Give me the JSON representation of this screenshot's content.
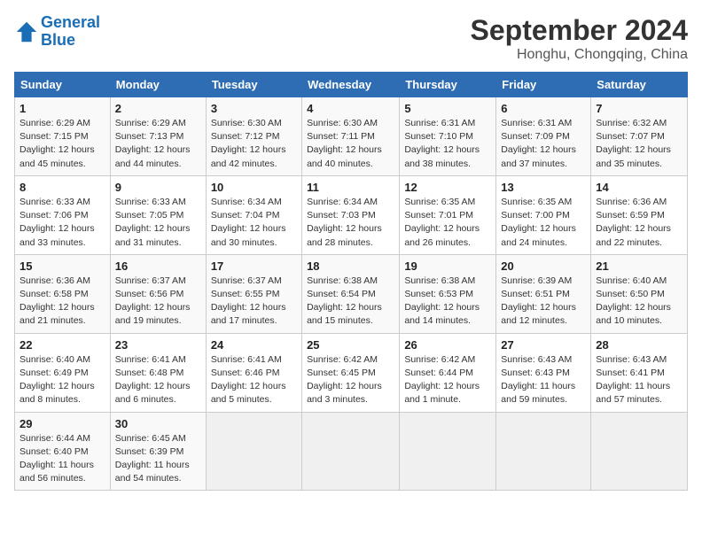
{
  "header": {
    "logo_line1": "General",
    "logo_line2": "Blue",
    "month": "September 2024",
    "location": "Honghu, Chongqing, China"
  },
  "days_of_week": [
    "Sunday",
    "Monday",
    "Tuesday",
    "Wednesday",
    "Thursday",
    "Friday",
    "Saturday"
  ],
  "weeks": [
    [
      {
        "num": "1",
        "sunrise": "6:29 AM",
        "sunset": "7:15 PM",
        "daylight": "12 hours and 45 minutes."
      },
      {
        "num": "2",
        "sunrise": "6:29 AM",
        "sunset": "7:13 PM",
        "daylight": "12 hours and 44 minutes."
      },
      {
        "num": "3",
        "sunrise": "6:30 AM",
        "sunset": "7:12 PM",
        "daylight": "12 hours and 42 minutes."
      },
      {
        "num": "4",
        "sunrise": "6:30 AM",
        "sunset": "7:11 PM",
        "daylight": "12 hours and 40 minutes."
      },
      {
        "num": "5",
        "sunrise": "6:31 AM",
        "sunset": "7:10 PM",
        "daylight": "12 hours and 38 minutes."
      },
      {
        "num": "6",
        "sunrise": "6:31 AM",
        "sunset": "7:09 PM",
        "daylight": "12 hours and 37 minutes."
      },
      {
        "num": "7",
        "sunrise": "6:32 AM",
        "sunset": "7:07 PM",
        "daylight": "12 hours and 35 minutes."
      }
    ],
    [
      {
        "num": "8",
        "sunrise": "6:33 AM",
        "sunset": "7:06 PM",
        "daylight": "12 hours and 33 minutes."
      },
      {
        "num": "9",
        "sunrise": "6:33 AM",
        "sunset": "7:05 PM",
        "daylight": "12 hours and 31 minutes."
      },
      {
        "num": "10",
        "sunrise": "6:34 AM",
        "sunset": "7:04 PM",
        "daylight": "12 hours and 30 minutes."
      },
      {
        "num": "11",
        "sunrise": "6:34 AM",
        "sunset": "7:03 PM",
        "daylight": "12 hours and 28 minutes."
      },
      {
        "num": "12",
        "sunrise": "6:35 AM",
        "sunset": "7:01 PM",
        "daylight": "12 hours and 26 minutes."
      },
      {
        "num": "13",
        "sunrise": "6:35 AM",
        "sunset": "7:00 PM",
        "daylight": "12 hours and 24 minutes."
      },
      {
        "num": "14",
        "sunrise": "6:36 AM",
        "sunset": "6:59 PM",
        "daylight": "12 hours and 22 minutes."
      }
    ],
    [
      {
        "num": "15",
        "sunrise": "6:36 AM",
        "sunset": "6:58 PM",
        "daylight": "12 hours and 21 minutes."
      },
      {
        "num": "16",
        "sunrise": "6:37 AM",
        "sunset": "6:56 PM",
        "daylight": "12 hours and 19 minutes."
      },
      {
        "num": "17",
        "sunrise": "6:37 AM",
        "sunset": "6:55 PM",
        "daylight": "12 hours and 17 minutes."
      },
      {
        "num": "18",
        "sunrise": "6:38 AM",
        "sunset": "6:54 PM",
        "daylight": "12 hours and 15 minutes."
      },
      {
        "num": "19",
        "sunrise": "6:38 AM",
        "sunset": "6:53 PM",
        "daylight": "12 hours and 14 minutes."
      },
      {
        "num": "20",
        "sunrise": "6:39 AM",
        "sunset": "6:51 PM",
        "daylight": "12 hours and 12 minutes."
      },
      {
        "num": "21",
        "sunrise": "6:40 AM",
        "sunset": "6:50 PM",
        "daylight": "12 hours and 10 minutes."
      }
    ],
    [
      {
        "num": "22",
        "sunrise": "6:40 AM",
        "sunset": "6:49 PM",
        "daylight": "12 hours and 8 minutes."
      },
      {
        "num": "23",
        "sunrise": "6:41 AM",
        "sunset": "6:48 PM",
        "daylight": "12 hours and 6 minutes."
      },
      {
        "num": "24",
        "sunrise": "6:41 AM",
        "sunset": "6:46 PM",
        "daylight": "12 hours and 5 minutes."
      },
      {
        "num": "25",
        "sunrise": "6:42 AM",
        "sunset": "6:45 PM",
        "daylight": "12 hours and 3 minutes."
      },
      {
        "num": "26",
        "sunrise": "6:42 AM",
        "sunset": "6:44 PM",
        "daylight": "12 hours and 1 minute."
      },
      {
        "num": "27",
        "sunrise": "6:43 AM",
        "sunset": "6:43 PM",
        "daylight": "11 hours and 59 minutes."
      },
      {
        "num": "28",
        "sunrise": "6:43 AM",
        "sunset": "6:41 PM",
        "daylight": "11 hours and 57 minutes."
      }
    ],
    [
      {
        "num": "29",
        "sunrise": "6:44 AM",
        "sunset": "6:40 PM",
        "daylight": "11 hours and 56 minutes."
      },
      {
        "num": "30",
        "sunrise": "6:45 AM",
        "sunset": "6:39 PM",
        "daylight": "11 hours and 54 minutes."
      },
      null,
      null,
      null,
      null,
      null
    ]
  ]
}
